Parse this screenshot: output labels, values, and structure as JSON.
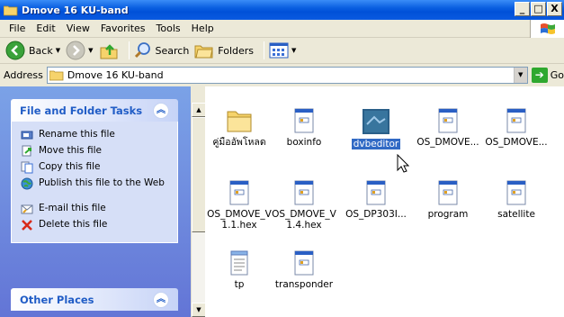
{
  "window": {
    "title": "Dmove 16 KU-band",
    "buttons": [
      "_",
      "□",
      "X"
    ]
  },
  "menu": {
    "items": [
      "File",
      "Edit",
      "View",
      "Favorites",
      "Tools",
      "Help"
    ]
  },
  "toolbar": {
    "back_label": "Back",
    "search_label": "Search",
    "folders_label": "Folders"
  },
  "address": {
    "label": "Address",
    "value": "Dmove 16 KU-band",
    "go_label": "Go"
  },
  "tasks": {
    "title": "File and Folder Tasks",
    "items": [
      {
        "label": "Rename this file",
        "icon": "rename-icon"
      },
      {
        "label": "Move this file",
        "icon": "move-icon"
      },
      {
        "label": "Copy this file",
        "icon": "copy-icon"
      },
      {
        "label": "Publish this file to the Web",
        "icon": "publish-icon"
      },
      {
        "label": "E-mail this file",
        "icon": "email-icon"
      },
      {
        "label": "Delete this file",
        "icon": "delete-icon"
      }
    ]
  },
  "other": {
    "title": "Other Places"
  },
  "files": [
    {
      "name": "คู่มืออัพโหลด",
      "type": "folder"
    },
    {
      "name": "boxinfo",
      "type": "doc"
    },
    {
      "name": "dvbeditor",
      "type": "app",
      "selected": true
    },
    {
      "name": "OS_DMOVE...",
      "type": "doc"
    },
    {
      "name": "OS_DMOVE...",
      "type": "doc"
    },
    {
      "name": "OS_DMOVE_V 1.1.hex",
      "type": "doc"
    },
    {
      "name": "OS_DMOVE_V 1.4.hex",
      "type": "doc"
    },
    {
      "name": "OS_DP303I...",
      "type": "doc"
    },
    {
      "name": "program",
      "type": "doc"
    },
    {
      "name": "satellite",
      "type": "doc"
    },
    {
      "name": "tp",
      "type": "notepad"
    },
    {
      "name": "transponder",
      "type": "doc"
    }
  ],
  "colors": {
    "title_blue": "#0a5fe0",
    "task_pane": "#6375d6",
    "selection": "#316ac5"
  }
}
